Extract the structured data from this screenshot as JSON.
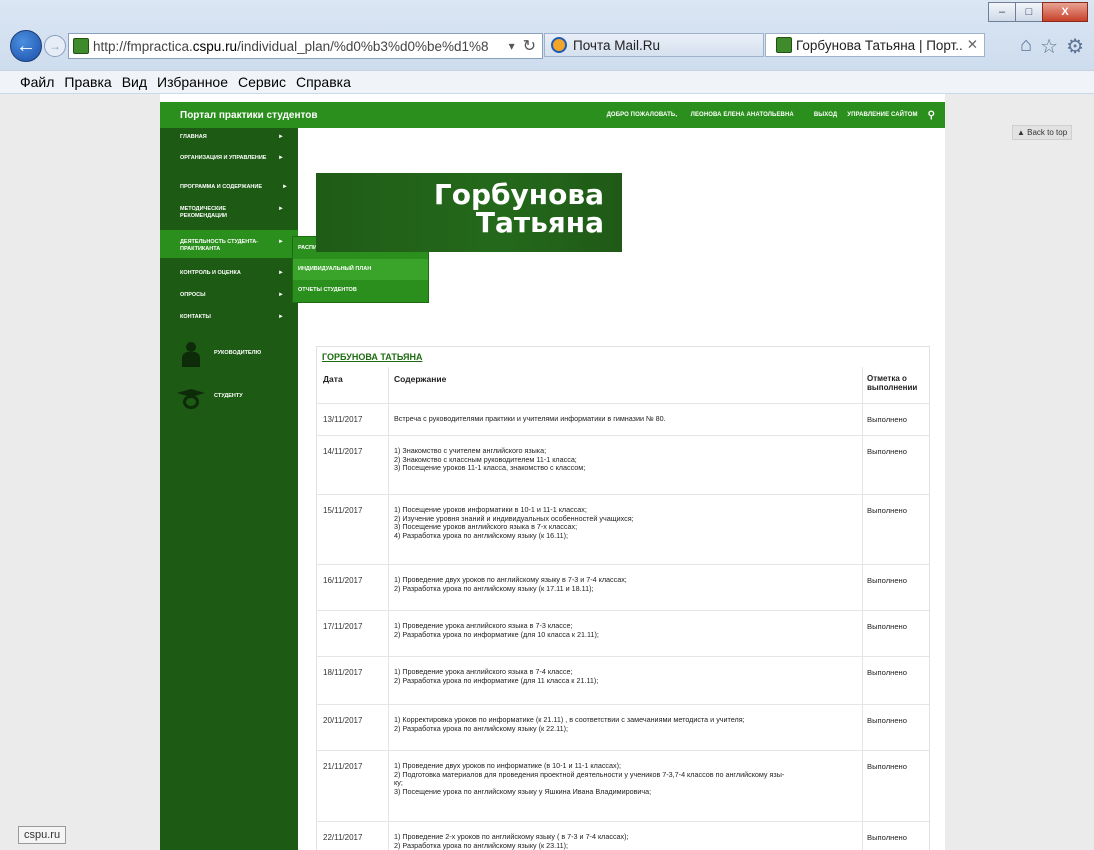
{
  "browser": {
    "url_prefix": "http://fmpractica.",
    "url_domain": "cspu.ru",
    "url_suffix": "/individual_plan/%d0%b3%d0%be%d1%8",
    "tabs": [
      {
        "label": "Почта Mail.Ru"
      },
      {
        "label": "Горбунова Татьяна | Порт..."
      }
    ],
    "menu": [
      "Файл",
      "Правка",
      "Вид",
      "Избранное",
      "Сервис",
      "Справка"
    ],
    "status_text": "cspu.ru"
  },
  "header": {
    "site_title": "Портал практики студентов",
    "welcome": "ДОБРО ПОЖАЛОВАТЬ,",
    "user": "ЛЕОНОВА ЕЛЕНА АНАТОЛЬЕВНА",
    "logout": "ВЫХОД",
    "manage": "УПРАВЛЕНИЕ САЙТОМ",
    "back_to_top": "▲ Back to top"
  },
  "sidebar": {
    "items": [
      {
        "label": "ГЛАВНАЯ"
      },
      {
        "label": "ОРГАНИЗАЦИЯ И УПРАВЛЕНИЕ"
      },
      {
        "label": "ПРОГРАММА И СОДЕРЖАНИЕ"
      },
      {
        "label": "МЕТОДИЧЕСКИЕ РЕКОМЕНДАЦИИ"
      },
      {
        "label": "ДЕЯТЕЛЬНОСТЬ СТУДЕНТА-ПРАКТИКАНТА"
      },
      {
        "label": "КОНТРОЛЬ И ОЦЕНКА"
      },
      {
        "label": "ОПРОСЫ"
      },
      {
        "label": "КОНТАКТЫ"
      }
    ],
    "leader_label": "РУКОВОДИТЕЛЮ",
    "student_label": "СТУДЕНТУ"
  },
  "submenu": [
    {
      "label": "РАСПИСАНИЕ ЗАНЯТИЙ"
    },
    {
      "label": "ИНДИВИДУАЛЬНЫЙ ПЛАН"
    },
    {
      "label": "ОТЧЕТЫ СТУДЕНТОВ"
    }
  ],
  "hero": {
    "line1": "Горбунова",
    "line2": "Татьяна"
  },
  "plan": {
    "name_link": "ГОРБУНОВА ТАТЬЯНА",
    "headers": {
      "date": "Дата",
      "content": "Содержание",
      "mark": "Отметка о выполнении"
    },
    "rows": [
      {
        "date": "13/11/2017",
        "mark": "Выполнено",
        "lines": [
          "Встреча с руководителями практики и учителями информатики в гимназии № 80."
        ]
      },
      {
        "date": "14/11/2017",
        "mark": "Выполнено",
        "lines": [
          "1) Знакомство с учителем английского языка;",
          "2) Знакомство с классным руководителем 11-1 класса;",
          "3) Посещение уроков 11-1 класса, знакомство с классом;"
        ]
      },
      {
        "date": "15/11/2017",
        "mark": "Выполнено",
        "lines": [
          "1) Посещение уроков информатики в 10-1 и 11-1 классах;",
          "2) Изучение уровня знаний и индивидуальных особенностей учащихся;",
          "3) Посещение уроков английского языка в 7-х классах;",
          "4) Разработка урока по английскому языку (к 16.11);"
        ]
      },
      {
        "date": "16/11/2017",
        "mark": "Выполнено",
        "lines": [
          "1) Проведение двух уроков по английскому языку в 7-3 и 7-4 классах;",
          "2) Разработка урока по английскому языку (к 17.11 и 18.11);"
        ]
      },
      {
        "date": "17/11/2017",
        "mark": "Выполнено",
        "lines": [
          "1) Проведение урока английского языка в 7-3 классе;",
          "2) Разработка урока по информатике (для 10 класса к 21.11);"
        ]
      },
      {
        "date": "18/11/2017",
        "mark": "Выполнено",
        "lines": [
          "1) Проведение урока английского языка в 7-4 классе;",
          "2) Разработка урока по информатике (для 11 класса к 21.11);"
        ]
      },
      {
        "date": "20/11/2017",
        "mark": "Выполнено",
        "lines": [
          "1) Корректировка уроков по информатике (к 21.11) , в соответствии с замечаниями методиста и учителя;",
          "2) Разработка урока по английскому языку (к 22.11);"
        ]
      },
      {
        "date": "21/11/2017",
        "mark": "Выполнено",
        "lines": [
          "1) Проведение двух уроков по информатике (в 10-1 и 11-1 классах);",
          "2) Подготовка материалов для проведения проектной деятельности у учеников 7-3,7-4 классов по английскому язы-",
          "ку;",
          "3) Посещение урока по английскому языку у Яшкина Ивана Владимировича;"
        ]
      },
      {
        "date": "22/11/2017",
        "mark": "Выполнено",
        "lines": [
          "1) Проведение 2-х уроков по английскому языку ( в 7-3 и 7-4 классах);",
          "2) Разработка урока по английскому языку (к 23.11);"
        ]
      }
    ]
  }
}
